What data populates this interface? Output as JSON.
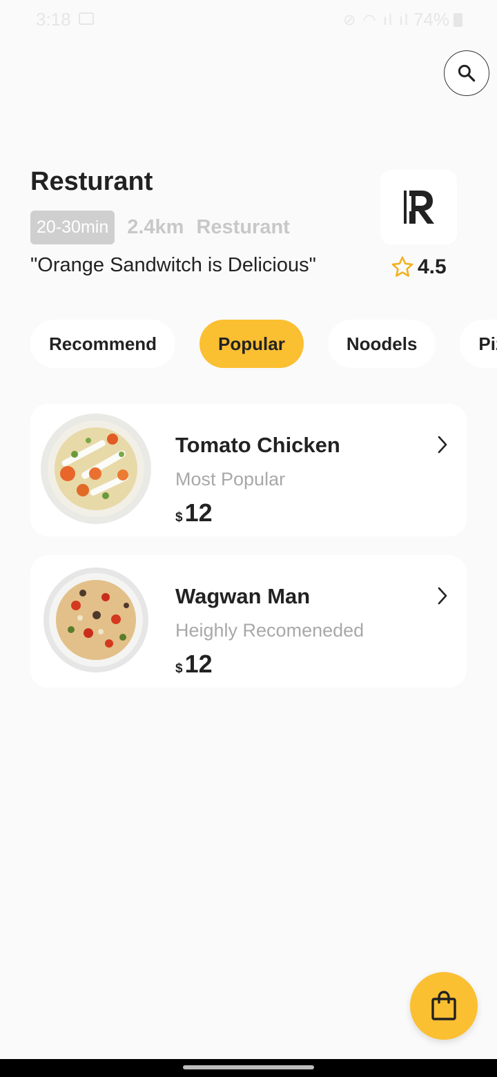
{
  "status_bar": {
    "time": "3:18",
    "battery": "74%"
  },
  "header": {
    "title": "Resturant",
    "time_badge": "20-30min",
    "distance": "2.4km",
    "category": "Resturant",
    "tagline": "\"Orange Sandwitch is Delicious\"",
    "rating": "4.5",
    "logo_letter": "R"
  },
  "chips": [
    "Recommend",
    "Popular",
    "Noodels",
    "Pizza"
  ],
  "active_chip": "Popular",
  "menu_items": [
    {
      "name": "Tomato Chicken",
      "subtitle": "Most Popular",
      "currency": "$",
      "price": "12"
    },
    {
      "name": "Wagwan Man",
      "subtitle": "Heighly Recomeneded",
      "currency": "$",
      "price": "12"
    }
  ],
  "icons": {
    "search": "search-icon",
    "star": "star-outline-icon",
    "chevron": "chevron-right-icon",
    "cart": "shopping-bag-icon"
  },
  "colors": {
    "accent": "#fbbf32",
    "background": "#fafafa",
    "muted_text": "#a8a8a8"
  }
}
